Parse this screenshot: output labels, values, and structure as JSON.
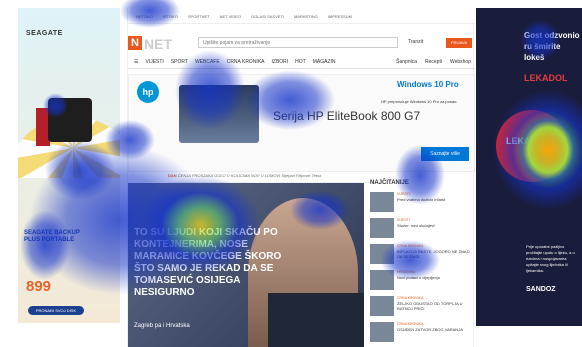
{
  "topnav": [
    "NETOKO",
    "ISTOKO",
    "SPORTNET",
    "NET VIDEO",
    "OGLASI SASVETI",
    "MARKETING",
    "IMPRESSUM"
  ],
  "site": {
    "logo_letter": "N",
    "logo_text": "NET",
    "search_placeholder": "Upišite pojam za pretraživanje",
    "tranzit": "Tranzit",
    "prijava": "PRIJAVA"
  },
  "menu": {
    "items": [
      "VIJESTI",
      "SPORT",
      "WEBCAFE",
      "CRNA KRONIKA",
      "IZBORI",
      "HOT",
      "MAGAZIN"
    ],
    "right": [
      "Šanpnica",
      "Recepti",
      "Webshop"
    ]
  },
  "banner": {
    "hp": "hp",
    "windows": "Windows 10 Pro",
    "windows_sub": "HP preporučuje Windows 10 Pro za posao.",
    "serija": "Serija HP EliteBook 800 G7",
    "cta": "Saznajte više"
  },
  "ticker": {
    "label": "DAN",
    "text": "ĆENJA PROSJAKA GOLO U KOLICIMA NOV U LOMOVI Stjepan Filipović Tekst"
  },
  "hero": {
    "title": "TO SU LJUDI KOJI SKAČU PO KONTEJNERIMA, NOSE MARAMICE KOVČEGE ŠKORO ŠTO SAMO JE REKAD DA SE TOMASEVIĆ OSIJEGA NESIGURNO",
    "sub": "Zagreb pa i Hrvatska"
  },
  "side": {
    "heading": "NAJČITANIJE",
    "items": [
      {
        "cat": "VIJESTI",
        "text": "Pred vratima doživio infarkt"
      },
      {
        "cat": "VIJESTI",
        "text": "Stožer: novi slučajevi"
      },
      {
        "cat": "CRNA KRONIKA",
        "text": "INFLACIJA RASTE, JOGORO NE ZNAO DA SE RADI"
      },
      {
        "cat": "HRVATSKA",
        "text": "Novi podaci o cijepljenju"
      },
      {
        "cat": "CRNA KRONIKA",
        "text": "ŽELJKO ODUSTAO OD TORPLJA U RATNOJ PRIČI"
      },
      {
        "cat": "CRNA KRONIKA",
        "text": "OSUĐEN ZATVOR ZBOG VARANJA"
      }
    ]
  },
  "left_ad": {
    "brand": "SEAGATE",
    "slogan": "SEAGATE BACKUP PLUS PORTABLE",
    "price": "899",
    "cta": "PRONAĐI SVOJ DISK"
  },
  "right_ad": {
    "head": "Gost odzvonio ru šmirite lokeš",
    "brand": "LEKADOL",
    "product": "LEKADOL",
    "body": "Prije uporabe pažljivo pročitajte uputu o lijeku, a o rizicima i nuspojavama upitajte svog liječnika ili ljekarnika.",
    "sandoz": "SANDOZ"
  },
  "heatmap": {
    "colors": {
      "low": "#1533c9",
      "mid": "#ffe400",
      "high": "#e31a1c"
    }
  }
}
